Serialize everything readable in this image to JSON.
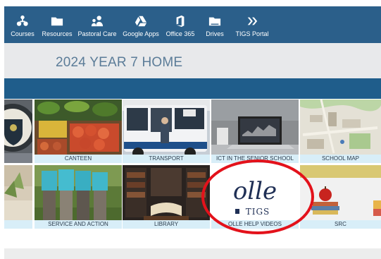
{
  "nav": [
    {
      "label": "Courses",
      "icon": "courses-icon"
    },
    {
      "label": "Resources",
      "icon": "folder-icon"
    },
    {
      "label": "Pastoral Care",
      "icon": "people-icon"
    },
    {
      "label": "Google Apps",
      "icon": "google-drive-icon"
    },
    {
      "label": "Office 365",
      "icon": "office-icon"
    },
    {
      "label": "Drives",
      "icon": "drive-folder-icon"
    },
    {
      "label": "TIGS Portal",
      "icon": "double-chevron-icon"
    }
  ],
  "page": {
    "title": "2024 YEAR 7 HOME"
  },
  "tiles": {
    "row1": [
      {
        "caption": "",
        "image": "school-crest"
      },
      {
        "caption": "CANTEEN",
        "image": "vegetables"
      },
      {
        "caption": "TRANSPORT",
        "image": "bus"
      },
      {
        "caption": "ICT IN THE SENIOR SCHOOL",
        "image": "laptop"
      },
      {
        "caption": "SCHOOL MAP",
        "image": "campus-map"
      }
    ],
    "row2": [
      {
        "caption": "",
        "image": "gardening"
      },
      {
        "caption": "SERVICE AND ACTION",
        "image": "students-group"
      },
      {
        "caption": "LIBRARY",
        "image": "library-books"
      },
      {
        "caption": "OLLE HELP VIDEOS",
        "image": "olle-logo",
        "logo_text": "olle",
        "logo_sub": "TIGS"
      },
      {
        "caption": "SRC",
        "image": "apple-books"
      }
    ]
  },
  "colors": {
    "nav_bg": "#2b5f8a",
    "strip": "#1f5d8b",
    "title_text": "#5b7c98",
    "caption_bg": "#d8eef8",
    "highlight": "#e3121b"
  }
}
